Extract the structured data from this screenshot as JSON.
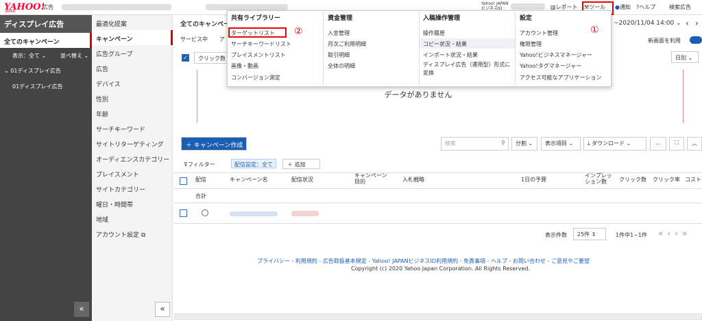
{
  "header": {
    "logo": "YAHOO!",
    "logo_sub": "JAPAN",
    "logo_ad": "広告",
    "business_id_label": "Yahoo! JAPAN ビジネスID",
    "report": "レポート",
    "tool": "ツール",
    "notify": "通知",
    "help": "ヘルプ",
    "search_ad": "検索広告"
  },
  "sidebar": {
    "title": "ディスプレイ広告",
    "active": "全てのキャンペーン",
    "display_filter": "表示：全て",
    "sort": "並べ替え",
    "tree_group": "01ディスプレイ広告",
    "tree_item": "01ディスプレイ広告",
    "collapse": "«"
  },
  "subnav": {
    "items": [
      "最適化提案",
      "キャンペーン",
      "広告グループ",
      "広告",
      "デバイス",
      "性別",
      "年齢",
      "サーチキーワード",
      "サイトリターゲティング",
      "オーディエンスカテゴリー",
      "プレイスメント",
      "サイトカテゴリー",
      "曜日・時間帯",
      "地域",
      "アカウント設定"
    ],
    "collapse": "«"
  },
  "main": {
    "title": "全てのキャンペーン",
    "tab_service": "サービス中",
    "tab_a": "ア",
    "click_label": "クリック数",
    "date_range": "~2020/11/04 14:00",
    "new_screen": "新画面を利用",
    "daily": "日別",
    "no_data": "データがありません",
    "create_button": "キャンペーン作成",
    "search_placeholder": "検索",
    "split": "分割",
    "display_items": "表示項目",
    "download": "ダウンロード",
    "more": "…",
    "filter": "フィルター",
    "delivery_setting": "配信設定：全て",
    "add": "追加",
    "columns": [
      "配信",
      "キャンペーン名",
      "配信状況",
      "キャンペーン目的",
      "入札戦略",
      "1日の予算",
      "インプレッション数",
      "クリック数",
      "クリック率",
      "コスト"
    ],
    "total_label": "合計",
    "per_page_label": "表示件数",
    "per_page_value": "25件",
    "pagination_info": "1件中1~1件"
  },
  "dropdown": {
    "col1": {
      "head": "共有ライブラリー",
      "items": [
        "ターゲットリスト",
        "サーチキーワードリスト",
        "プレイスメントリスト",
        "画像・動画",
        "コンバージョン測定"
      ]
    },
    "col2": {
      "head": "資金管理",
      "items": [
        "入金管理",
        "月次ご利用明細",
        "取引明細",
        "全体の明細"
      ]
    },
    "col3": {
      "head": "入稿操作管理",
      "items": [
        "操作履歴",
        "コピー状況・結果",
        "インポート状況・結果",
        "ディスプレイ広告（運用型）形式に",
        "変換"
      ]
    },
    "col4": {
      "head": "設定",
      "items": [
        "アカウント管理",
        "権限管理",
        "Yahoo!ビジネスマネージャー",
        "Yahoo!タグマネージャー",
        "アクセス可能なアプリケーション"
      ]
    }
  },
  "annotations": {
    "one": "①",
    "two": "②"
  },
  "footer": {
    "links": [
      "プライバシー",
      "利用規約",
      "広告取扱基本規定",
      "Yahoo! JAPANビジネスID利用規約",
      "免責事項",
      "ヘルプ",
      "お問い合わせ",
      "ご意見やご要望"
    ],
    "copyright": "Copyright (c) 2020 Yahoo Japan Corporation. All Rights Reserved."
  }
}
